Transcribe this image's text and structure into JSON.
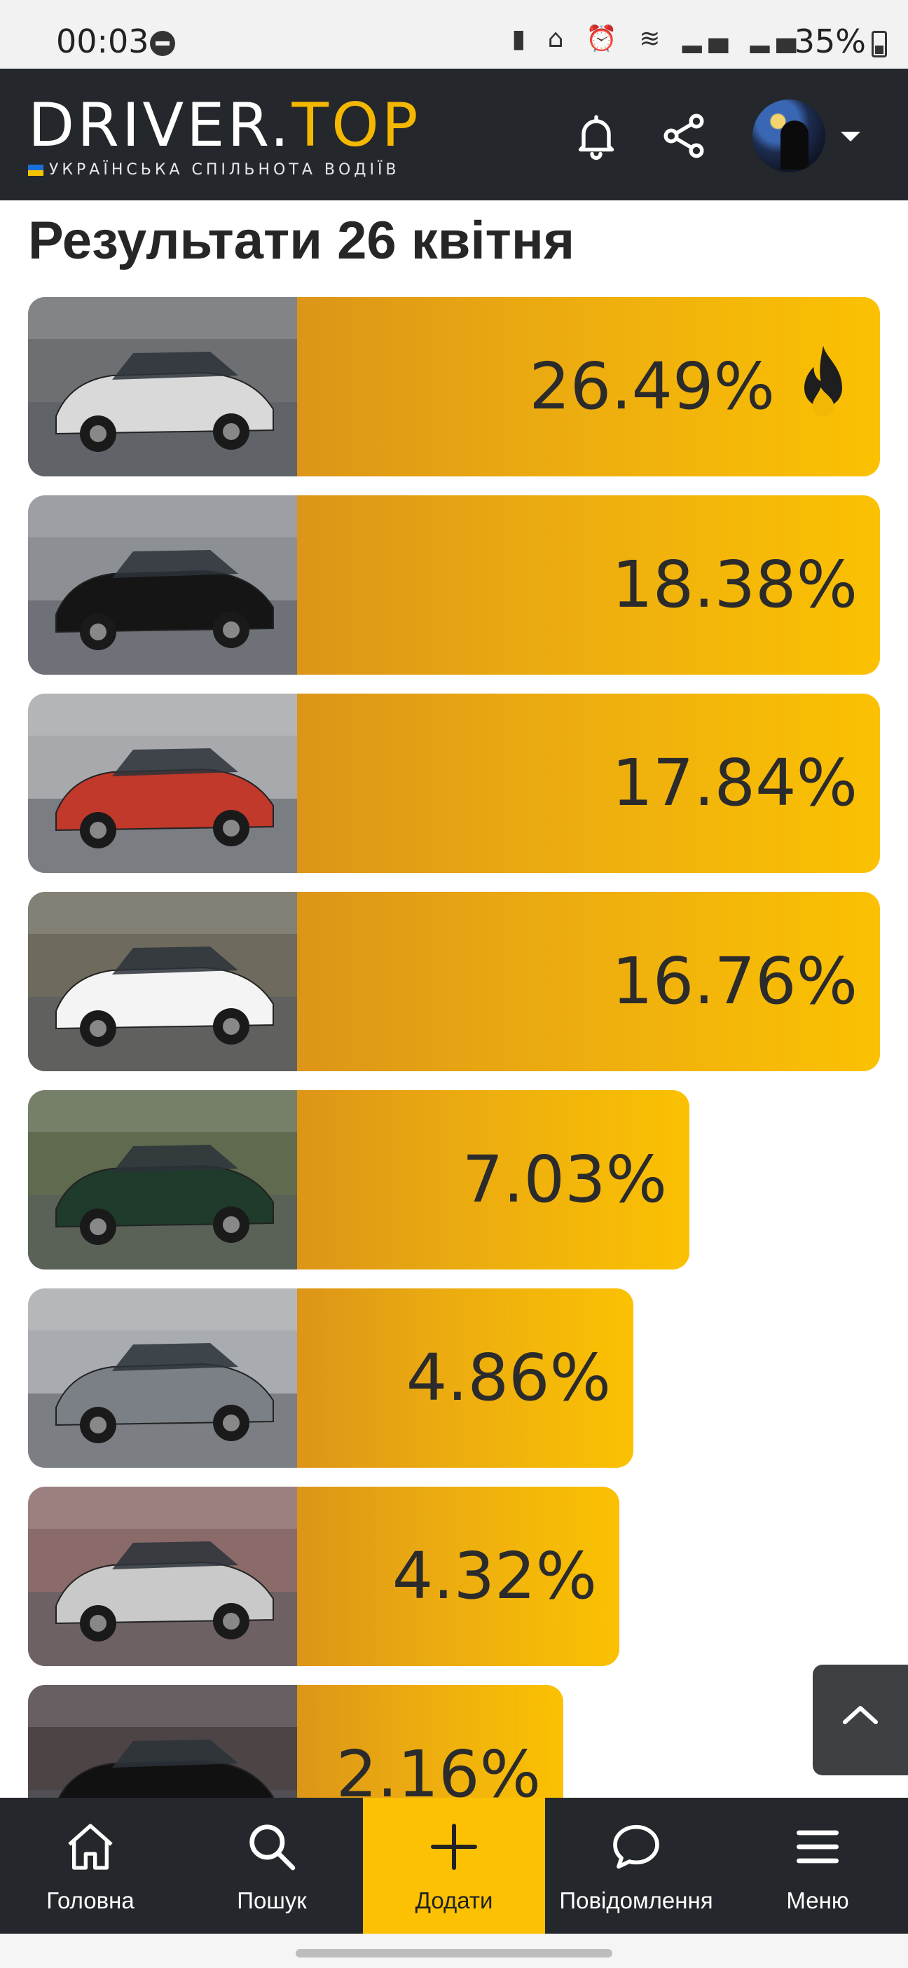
{
  "status_bar": {
    "time": "00:03",
    "icons": "▮ ⌂ ⏰ ≋ ▂▄ ▂▄",
    "battery": "35%"
  },
  "header": {
    "logo_white": "DRIVER.",
    "logo_yellow": "TOP",
    "logo_sub": "УКРАЇНСЬКА СПІЛЬНОТА ВОДІЇВ"
  },
  "page_title": "Результати 26 квітня",
  "results": [
    {
      "percent": "26.49%",
      "share": 26.49,
      "top": true,
      "car_color": "#d9d9d9",
      "bg": "#6d6f72"
    },
    {
      "percent": "18.38%",
      "share": 18.38,
      "top": false,
      "car_color": "#151515",
      "bg": "#8c8f94"
    },
    {
      "percent": "17.84%",
      "share": 17.84,
      "top": false,
      "car_color": "#c0392b",
      "bg": "#a7a9ad"
    },
    {
      "percent": "16.76%",
      "share": 16.76,
      "top": false,
      "car_color": "#f4f4f4",
      "bg": "#6e6a5d"
    },
    {
      "percent": "7.03%",
      "share": 7.03,
      "top": false,
      "car_color": "#1f3b2c",
      "bg": "#5f6a4f"
    },
    {
      "percent": "4.86%",
      "share": 4.86,
      "top": false,
      "car_color": "#7b7f86",
      "bg": "#a8acb0"
    },
    {
      "percent": "4.32%",
      "share": 4.32,
      "top": false,
      "car_color": "#c9c9c9",
      "bg": "#8b6a6a"
    },
    {
      "percent": "2.16%",
      "share": 2.16,
      "top": false,
      "car_color": "#111111",
      "bg": "#4d4446"
    }
  ],
  "bottom_nav": {
    "home": "Головна",
    "search": "Пошук",
    "add": "Додати",
    "messages": "Повідомлення",
    "menu": "Меню"
  },
  "colors": {
    "accent": "#fbc102",
    "header_bg": "#24272b",
    "bar_start": "#dc9518"
  }
}
